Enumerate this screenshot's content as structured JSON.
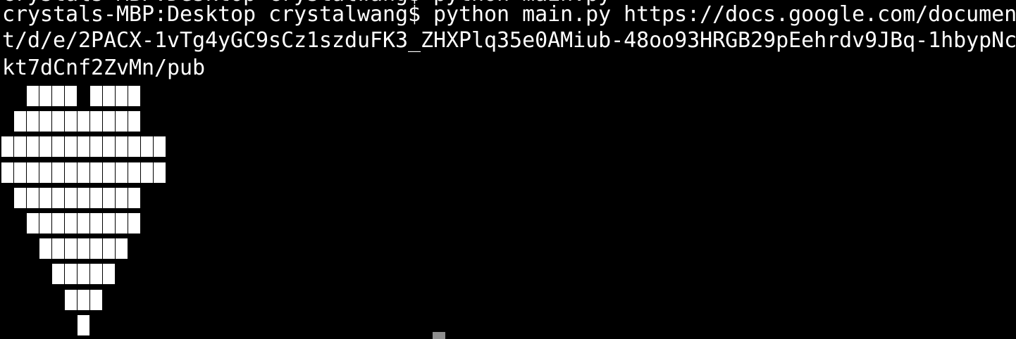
{
  "terminal": {
    "previous_line": "crystals-MBP:Desktop crystalwang$ python main.py",
    "command_line": "crystals-MBP:Desktop crystalwang$ python main.py https://docs.google.com/documen",
    "wrap_line_1": "t/d/e/2PACX-1vTg4yGC9sCz1szduFK3_ZHXPlq35e0AMiub-48oo93HRGB29pEehrdv9JBq-1hbypNc",
    "wrap_line_2": "kt7dCnf2ZvMn/pub",
    "output_art": {
      "glyph": "█",
      "rows": [
        " ████ ████",
        "██████████",
        "█████████████",
        "█████████████",
        " ██████████",
        "  █████████",
        "   ███████",
        "    █████",
        "     ███",
        "      █"
      ]
    },
    "colors": {
      "background": "#000000",
      "foreground": "#ffffff",
      "cursor": "#8e8e8e"
    }
  }
}
